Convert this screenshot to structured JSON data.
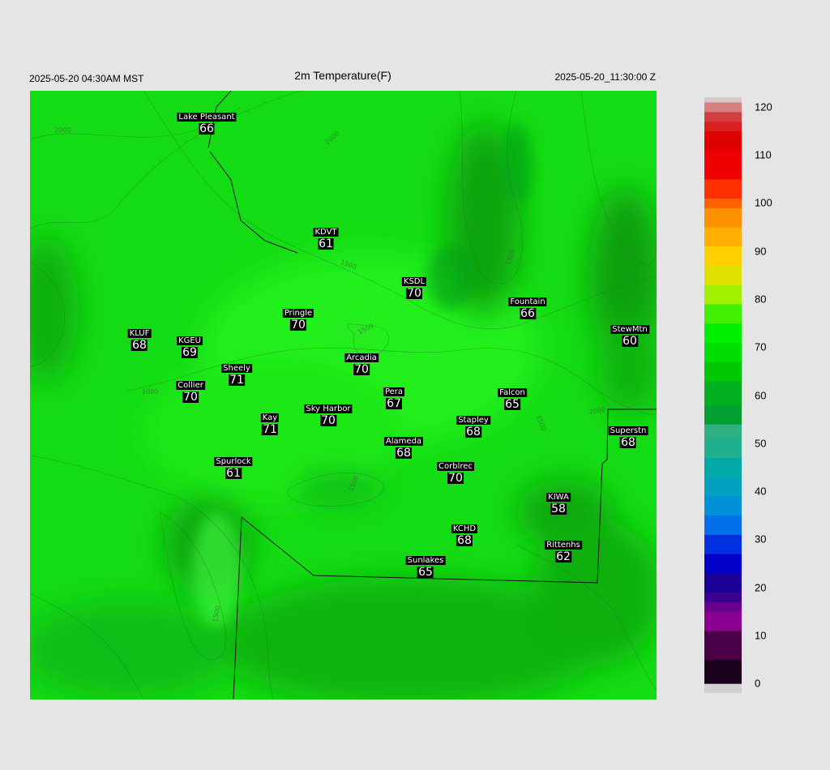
{
  "header": {
    "left_time": "2025-05-20 04:30AM MST",
    "title": "2m Temperature(F)",
    "right_time": "2025-05-20_11:30:00 Z"
  },
  "stations": [
    {
      "name": "Lake Pleasant",
      "value": "66"
    },
    {
      "name": "KDVT",
      "value": "61"
    },
    {
      "name": "KSDL",
      "value": "70"
    },
    {
      "name": "Fountain",
      "value": "66"
    },
    {
      "name": "StewMtn",
      "value": "60"
    },
    {
      "name": "Pringle",
      "value": "70"
    },
    {
      "name": "KLUF",
      "value": "68"
    },
    {
      "name": "KGEU",
      "value": "69"
    },
    {
      "name": "Arcadia",
      "value": "70"
    },
    {
      "name": "Sheely",
      "value": "71"
    },
    {
      "name": "Collier",
      "value": "70"
    },
    {
      "name": "Pera",
      "value": "67"
    },
    {
      "name": "Falcon",
      "value": "65"
    },
    {
      "name": "Sky Harbor",
      "value": "70"
    },
    {
      "name": "Kay",
      "value": "71"
    },
    {
      "name": "Stapley",
      "value": "68"
    },
    {
      "name": "Superstn",
      "value": "68"
    },
    {
      "name": "Alameda",
      "value": "68"
    },
    {
      "name": "Spurlock",
      "value": "61"
    },
    {
      "name": "Corblrec",
      "value": "70"
    },
    {
      "name": "KIWA",
      "value": "58"
    },
    {
      "name": "KCHD",
      "value": "68"
    },
    {
      "name": "Rittenhs",
      "value": "62"
    },
    {
      "name": "Sunlakes",
      "value": "65"
    }
  ],
  "contour_labels": [
    "2000",
    "2000",
    "1500",
    "1500",
    "1000",
    "1500",
    "2000",
    "1500",
    "1500",
    "1500"
  ],
  "colorbar": {
    "ticks": [
      "120",
      "110",
      "100",
      "90",
      "80",
      "70",
      "60",
      "50",
      "40",
      "30",
      "20",
      "10",
      "0"
    ],
    "min": 0,
    "max": 120
  }
}
